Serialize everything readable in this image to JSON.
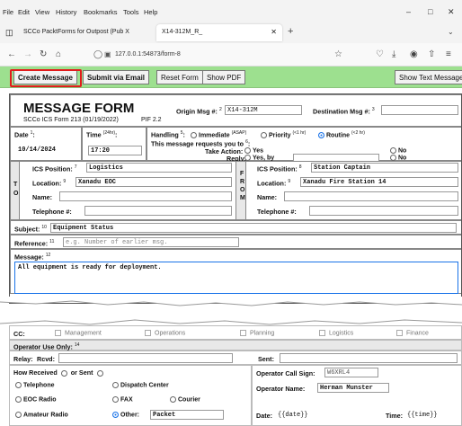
{
  "menu": {
    "file": "File",
    "edit": "Edit",
    "view": "View",
    "history": "History",
    "bookmarks": "Bookmarks",
    "tools": "Tools",
    "help": "Help"
  },
  "tabs": [
    {
      "label": "SCCo PacktForms for Outpost (Pub X"
    },
    {
      "label": "X14-312M_R_"
    }
  ],
  "address": {
    "url": "127.0.0.1:54873/form-8"
  },
  "toolbar": {
    "create": "Create Message",
    "submit": "Submit via Email",
    "reset": "Reset Form",
    "show_pdf": "Show PDF",
    "show_text": "Show Text Message"
  },
  "form": {
    "title": "MESSAGE FORM",
    "subtitle": "SCCo ICS Form 213 (01/19/2022)",
    "pif": "PIF 2.2",
    "origin_label": "Origin Msg #:",
    "origin_num": "2",
    "origin_value": "X14-312M",
    "dest_label": "Destination Msg #:",
    "dest_num": "3",
    "date_label": "Date",
    "date_num": "1",
    "date_value": "10/14/2024",
    "time_label": "Time",
    "time_hint": "(24hr)",
    "time_value": "17:20",
    "handling_label": "Handling",
    "handling_num": "5",
    "h_immediate": "Immediate",
    "h_immediate_hint": "(ASAP)",
    "h_priority": "Priority",
    "h_priority_hint": "(<1 hr)",
    "h_routine": "Routine",
    "h_routine_hint": "(<2 hr)",
    "requests_label": "This message requests you to",
    "requests_num": "6",
    "take_action": "Take Action:",
    "reply": "Reply:",
    "yes": "Yes",
    "yes_by": "Yes, by",
    "no": "No",
    "to_letters": "T O",
    "from_letters": "F R O M",
    "to_ics_label": "ICS Position:",
    "to_ics_num": "7",
    "to_ics_value": "Logistics",
    "to_loc_label": "Location:",
    "to_loc_num": "9",
    "to_loc_value": "Xanadu EOC",
    "to_name_label": "Name:",
    "to_tel_label": "Telephone #:",
    "from_ics_label": "ICS Position:",
    "from_ics_num": "8",
    "from_ics_value": "Station Captain",
    "from_loc_label": "Location:",
    "from_loc_num": "9",
    "from_loc_value": "Xanadu Fire Station 14",
    "from_name_label": "Name:",
    "from_tel_label": "Telephone #:",
    "subject_label": "Subject:",
    "subject_num": "10",
    "subject_value": "Equipment Status",
    "reference_label": "Reference:",
    "reference_num": "11",
    "reference_placeholder": "e.g. Number of earlier msg.",
    "message_label": "Message:",
    "message_num": "12",
    "message_value": "All equipment is ready for deployment."
  },
  "lower": {
    "cc_label": "CC:",
    "cc_items": [
      "Management",
      "Operations",
      "Planning",
      "Logistics",
      "Finance"
    ],
    "operator_use": "Operator Use Only:",
    "operator_num": "14",
    "relay_label": "Relay:",
    "rcvd_label": "Rcvd:",
    "sent_label": "Sent:",
    "how_received": "How Received",
    "or_sent": "or Sent",
    "telephone": "Telephone",
    "dispatch": "Dispatch Center",
    "eoc_radio": "EOC Radio",
    "fax": "FAX",
    "courier": "Courier",
    "amateur_radio": "Amateur Radio",
    "other_label": "Other:",
    "other_value": "Packet",
    "op_call_label": "Operator Call Sign:",
    "op_call_value": "W6XRL4",
    "op_name_label": "Operator Name:",
    "op_name_value": "Herman Munster",
    "date_label": "Date:",
    "date_value": "{{date}}",
    "time_label": "Time:",
    "time_value": "{{time}}"
  },
  "colors": {
    "toolbar_green": "#9de08f",
    "highlight_red": "#e21c1c",
    "accent_blue": "#1a73e8"
  }
}
